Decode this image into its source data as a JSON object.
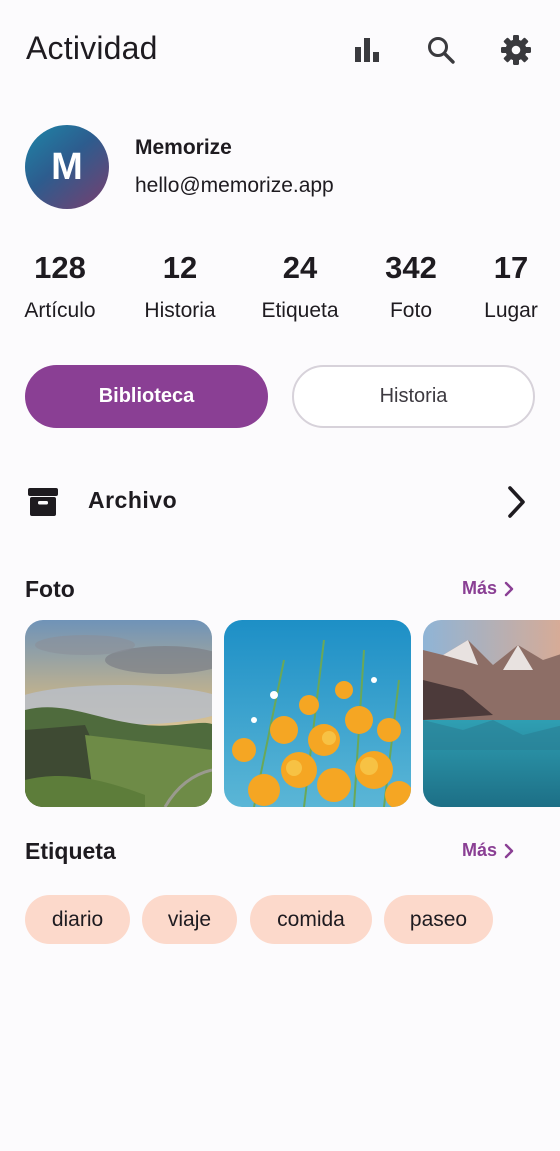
{
  "appbar": {
    "title": "Actividad",
    "icons": [
      "bar-chart-icon",
      "search-icon",
      "settings-gear-icon"
    ]
  },
  "profile": {
    "avatar_letter": "M",
    "name": "Memorize",
    "email": "hello@memorize.app"
  },
  "stats": [
    {
      "value": "128",
      "label": "Artículo"
    },
    {
      "value": "12",
      "label": "Historia"
    },
    {
      "value": "24",
      "label": "Etiqueta"
    },
    {
      "value": "342",
      "label": "Foto"
    },
    {
      "value": "17",
      "label": "Lugar"
    }
  ],
  "tabs": [
    {
      "label": "Biblioteca",
      "selected": true
    },
    {
      "label": "Historia",
      "selected": false
    }
  ],
  "archive": {
    "label": "Archivo",
    "icon": "archive-box-icon"
  },
  "photos_section": {
    "title": "Foto",
    "more_label": "Más",
    "items": [
      "photo-mountain-valley",
      "photo-orange-poppies",
      "photo-mountain-lake"
    ]
  },
  "tags_section": {
    "title": "Etiqueta",
    "more_label": "Más",
    "tags": [
      "diario",
      "viaje",
      "comida",
      "paseo"
    ]
  },
  "colors": {
    "accent": "#8a3f94",
    "tag_background": "#fcd9cb",
    "background": "#fcfbfd"
  }
}
